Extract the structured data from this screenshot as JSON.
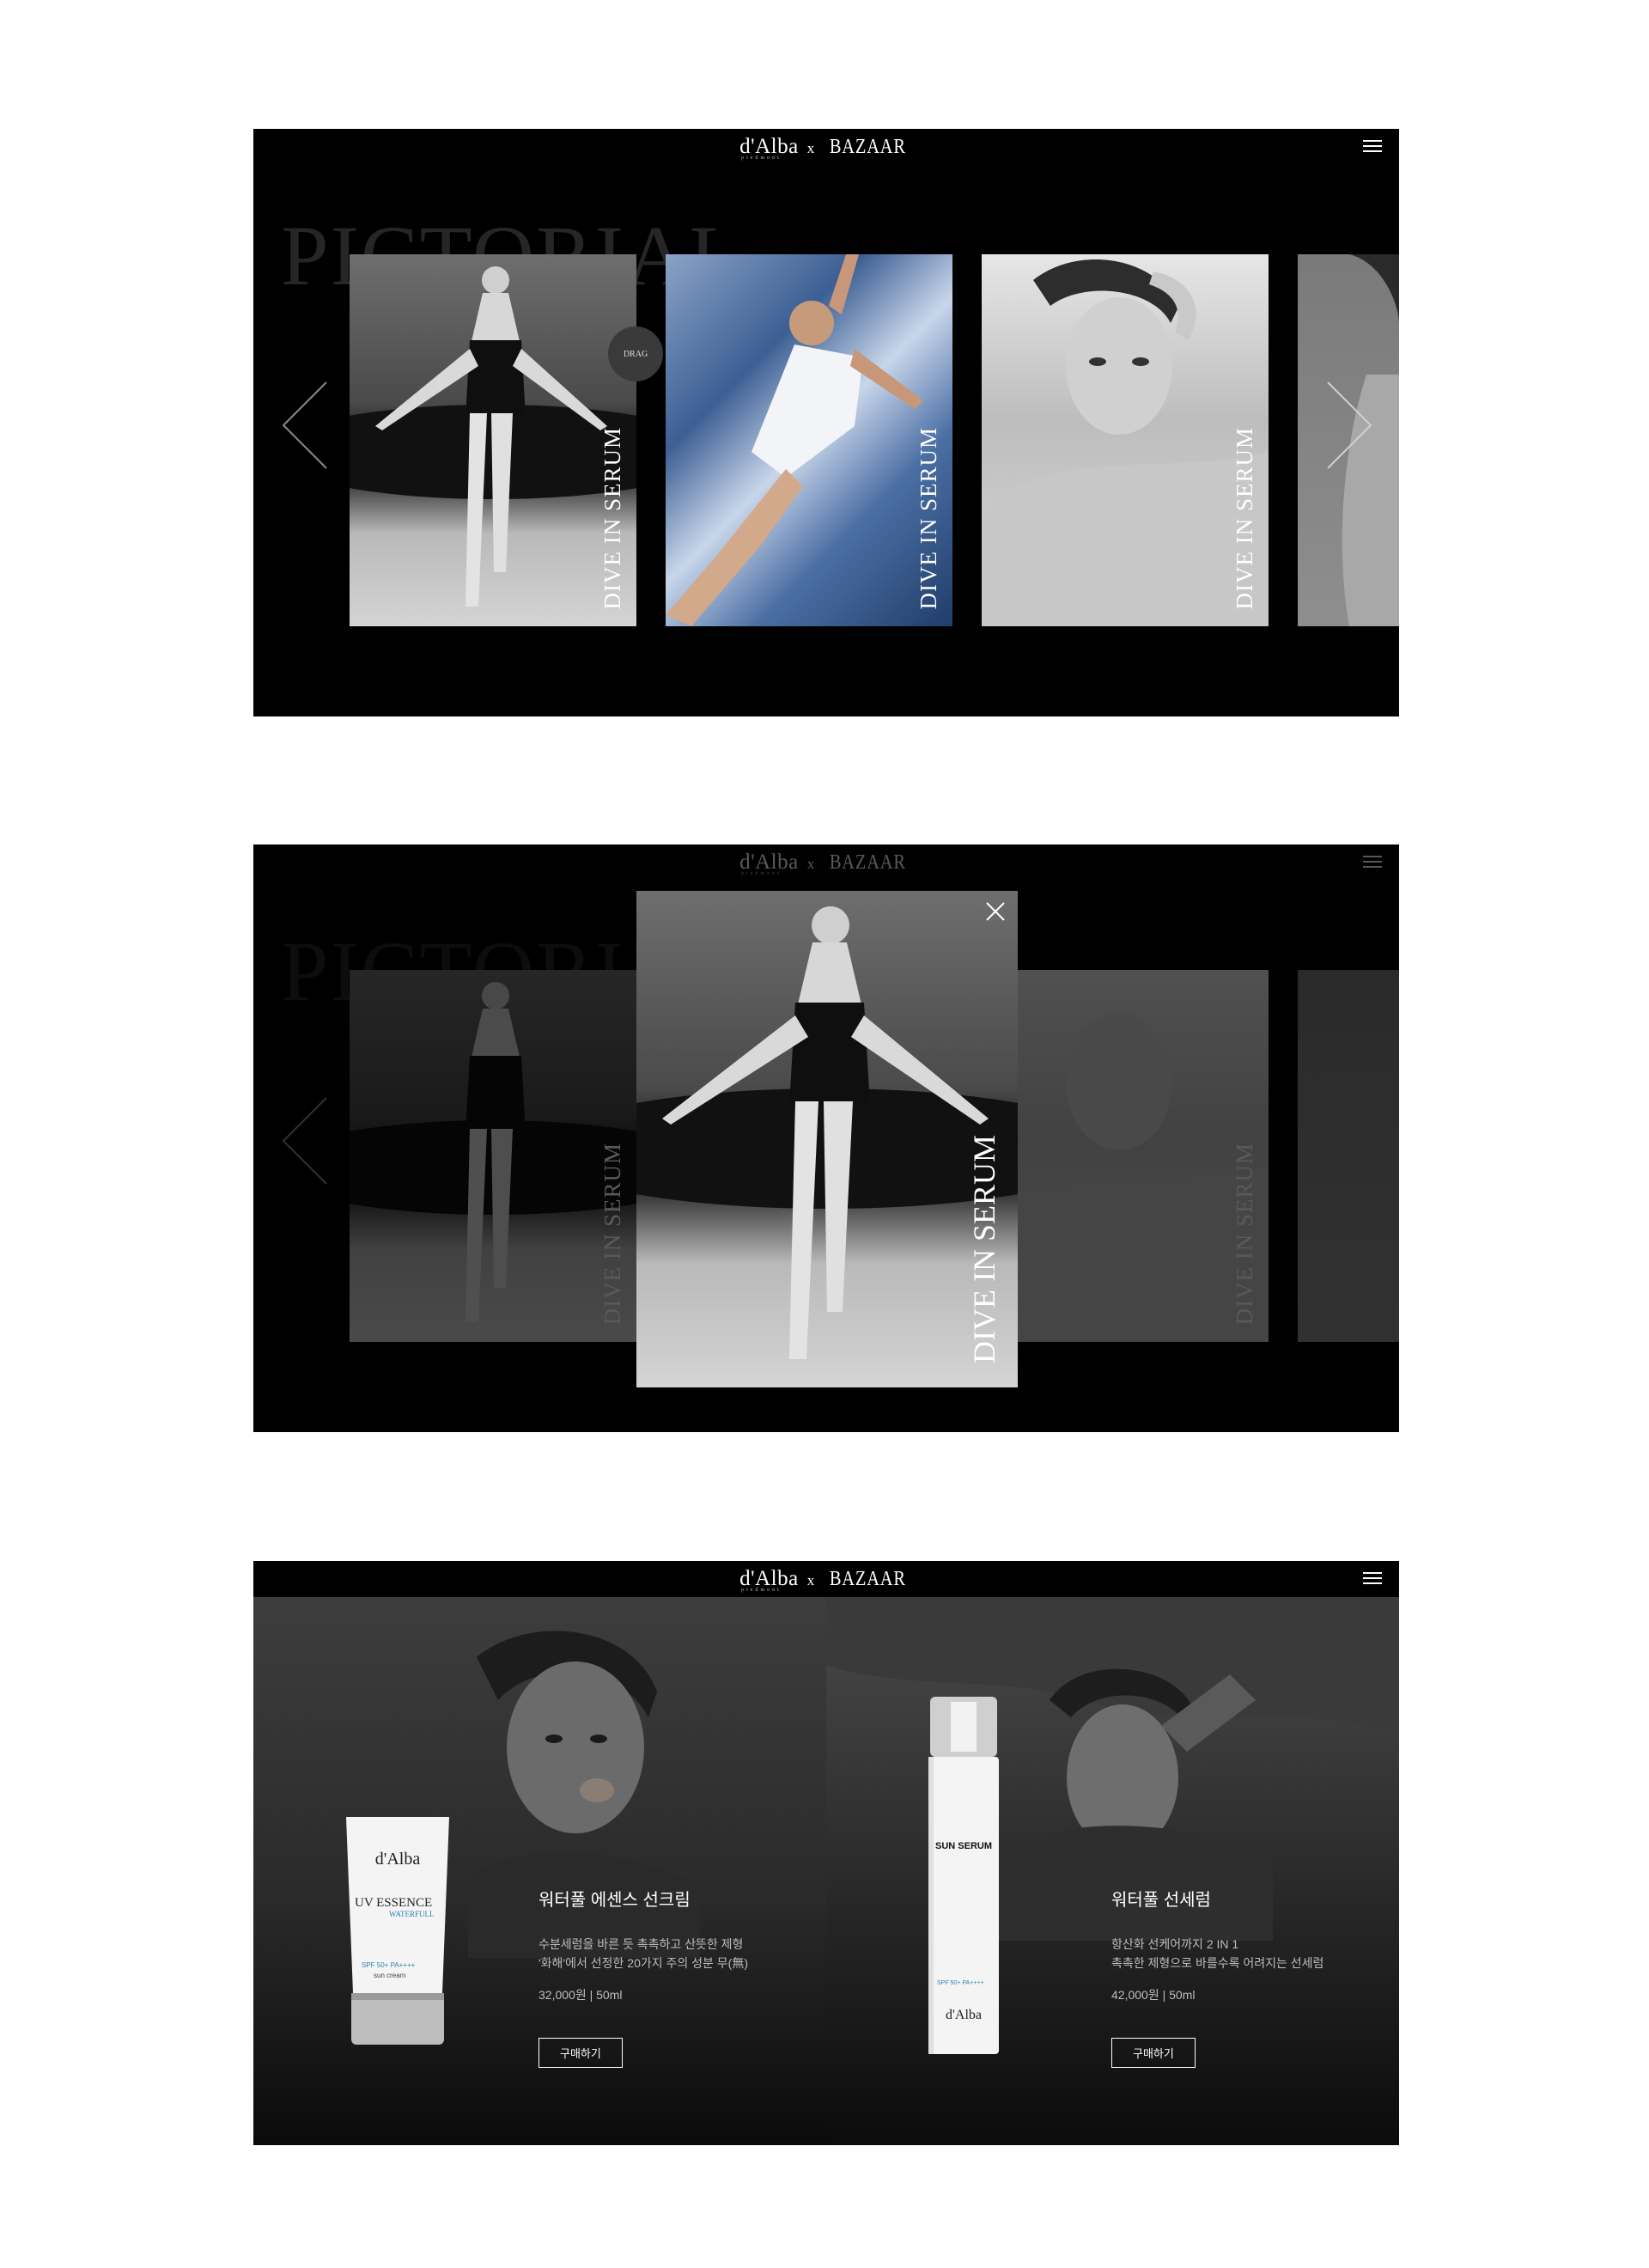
{
  "header": {
    "logo_brand": "d'Alba",
    "logo_sub": "piedmont",
    "logo_x": "x",
    "logo_partner": "BAZAAR"
  },
  "pictorial": {
    "title": "PICTORIAL",
    "drag_label": "DRAG",
    "slides": [
      {
        "caption": "DIVE IN SERUM"
      },
      {
        "caption": "DIVE IN SERUM"
      },
      {
        "caption": "DIVE IN SERUM"
      }
    ]
  },
  "modal": {
    "caption": "DIVE IN SERUM"
  },
  "products": [
    {
      "name": "워터풀 에센스 선크림",
      "desc_line1": "수분세럼을 바른 듯 촉촉하고 산뜻한 제형",
      "desc_line2": "'화해'에서 선정한 20가지 주의 성분 무(無)",
      "price": "32,000원 | 50ml",
      "buy_label": "구매하기",
      "pack_brand": "d'Alba",
      "pack_title": "UV ESSENCE",
      "pack_sub": "WATERFULL",
      "pack_spf": "SPF 50+ PA++++",
      "pack_type": "sun cream"
    },
    {
      "name": "워터풀 선세럼",
      "desc_line1": "항산화 선케어까지 2 IN 1",
      "desc_line2": "촉촉한 제형으로 바를수록 어려지는 선세럼",
      "price": "42,000원 | 50ml",
      "buy_label": "구매하기",
      "pack_brand": "d'Alba",
      "pack_title": "SUN SERUM",
      "pack_spf": "SPF 50+ PA++++"
    }
  ]
}
